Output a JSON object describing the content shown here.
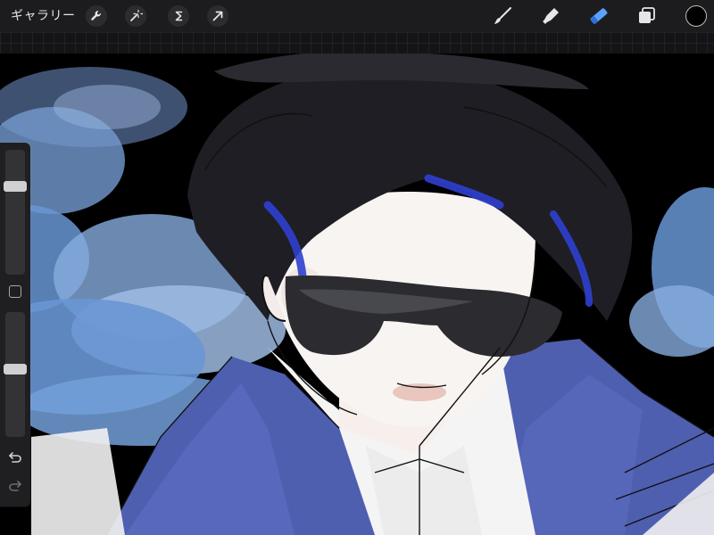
{
  "app": {
    "gallery_label": "ギャラリー"
  },
  "toolbar_left": {
    "icons": [
      "wrench-icon",
      "magic-wand-icon",
      "selection-s-icon",
      "move-arrow-icon"
    ]
  },
  "toolbar_right": {
    "icons": [
      "brush-icon",
      "smudge-icon",
      "eraser-icon",
      "layers-icon"
    ],
    "active_tool": "eraser",
    "active_color": "#5aa0ff",
    "current_color": "#000000"
  },
  "sidebar": {
    "brush_size_level": 0.73,
    "opacity_level": 0.55,
    "icons": [
      "modify-square-icon",
      "undo-icon",
      "redo-icon"
    ]
  },
  "canvas": {
    "background": "#000000",
    "palette": [
      "#6f9fe0",
      "#4f5fb0",
      "#2f3fd0",
      "#1e1e24",
      "#f4f0ee",
      "#e9c6be"
    ]
  }
}
